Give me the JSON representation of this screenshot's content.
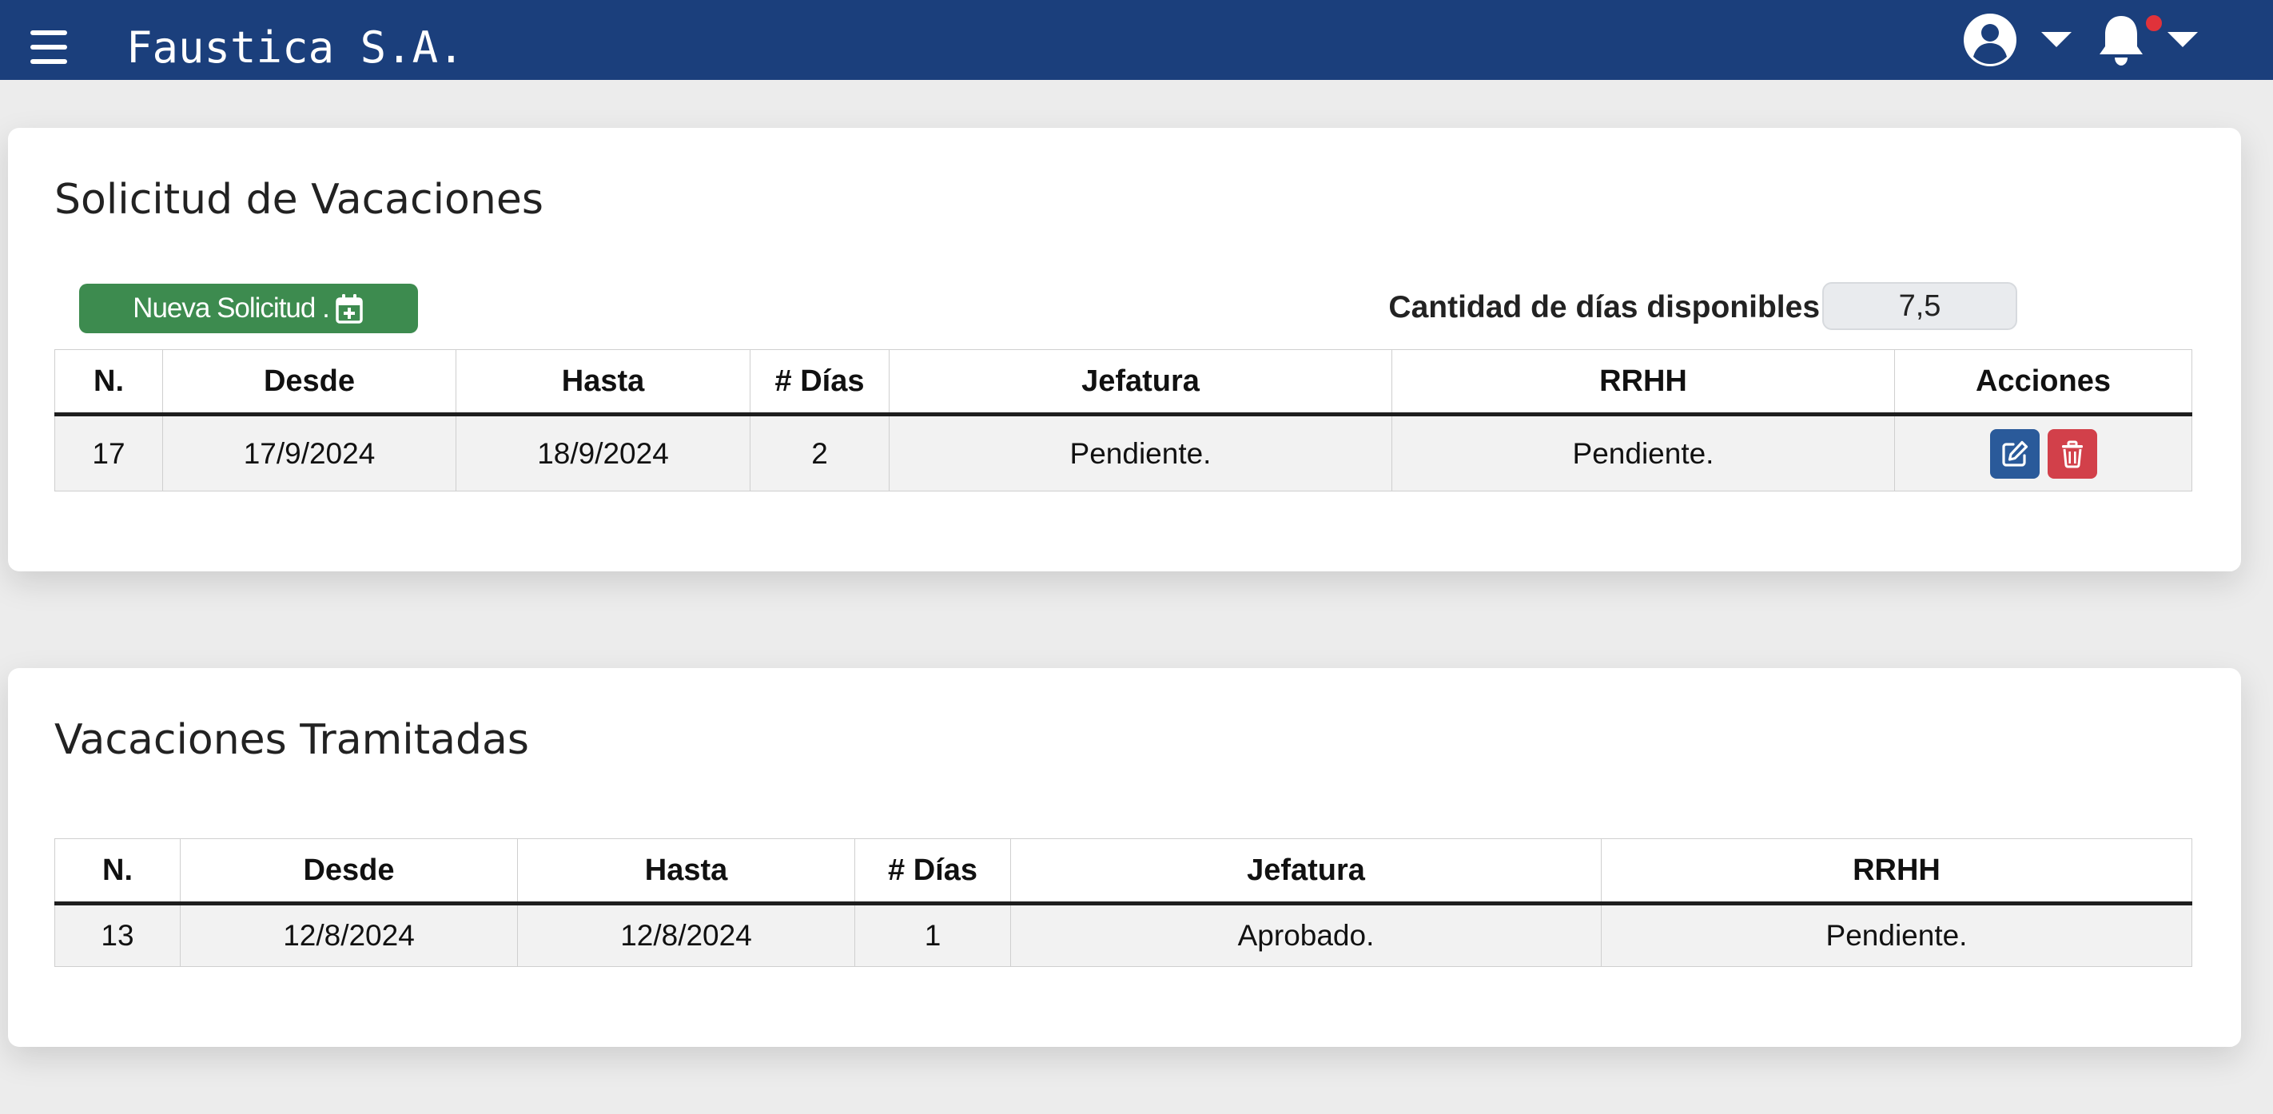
{
  "header": {
    "brand": "Faustica S.A.",
    "menu_icon": "hamburger-menu-icon",
    "user_icon": "user-circle-icon",
    "notification_icon": "bell-icon",
    "colors": {
      "bar": "#1b3f7c",
      "notification_dot": "#e0323a"
    }
  },
  "solicitud": {
    "title": "Solicitud de Vacaciones",
    "new_button_label": "Nueva Solicitud .",
    "new_button_icon": "calendar-plus-icon",
    "available_label": "Cantidad de días disponibles:",
    "available_value": "7,5",
    "table": {
      "headers": [
        "N.",
        "Desde",
        "Hasta",
        "# Días",
        "Jefatura",
        "RRHH",
        "Acciones"
      ],
      "rows": [
        {
          "n": "17",
          "desde": "17/9/2024",
          "hasta": "18/9/2024",
          "dias": "2",
          "jefatura": "Pendiente.",
          "rrhh": "Pendiente."
        }
      ],
      "actions": {
        "edit_icon": "edit-icon",
        "delete_icon": "trash-icon"
      }
    },
    "colors": {
      "button": "#3d8b4f",
      "edit": "#2a5a9a",
      "delete": "#d2404a"
    }
  },
  "tramitadas": {
    "title": "Vacaciones Tramitadas",
    "table": {
      "headers": [
        "N.",
        "Desde",
        "Hasta",
        "# Días",
        "Jefatura",
        "RRHH"
      ],
      "rows": [
        {
          "n": "13",
          "desde": "12/8/2024",
          "hasta": "12/8/2024",
          "dias": "1",
          "jefatura": "Aprobado.",
          "rrhh": "Pendiente."
        }
      ]
    }
  }
}
